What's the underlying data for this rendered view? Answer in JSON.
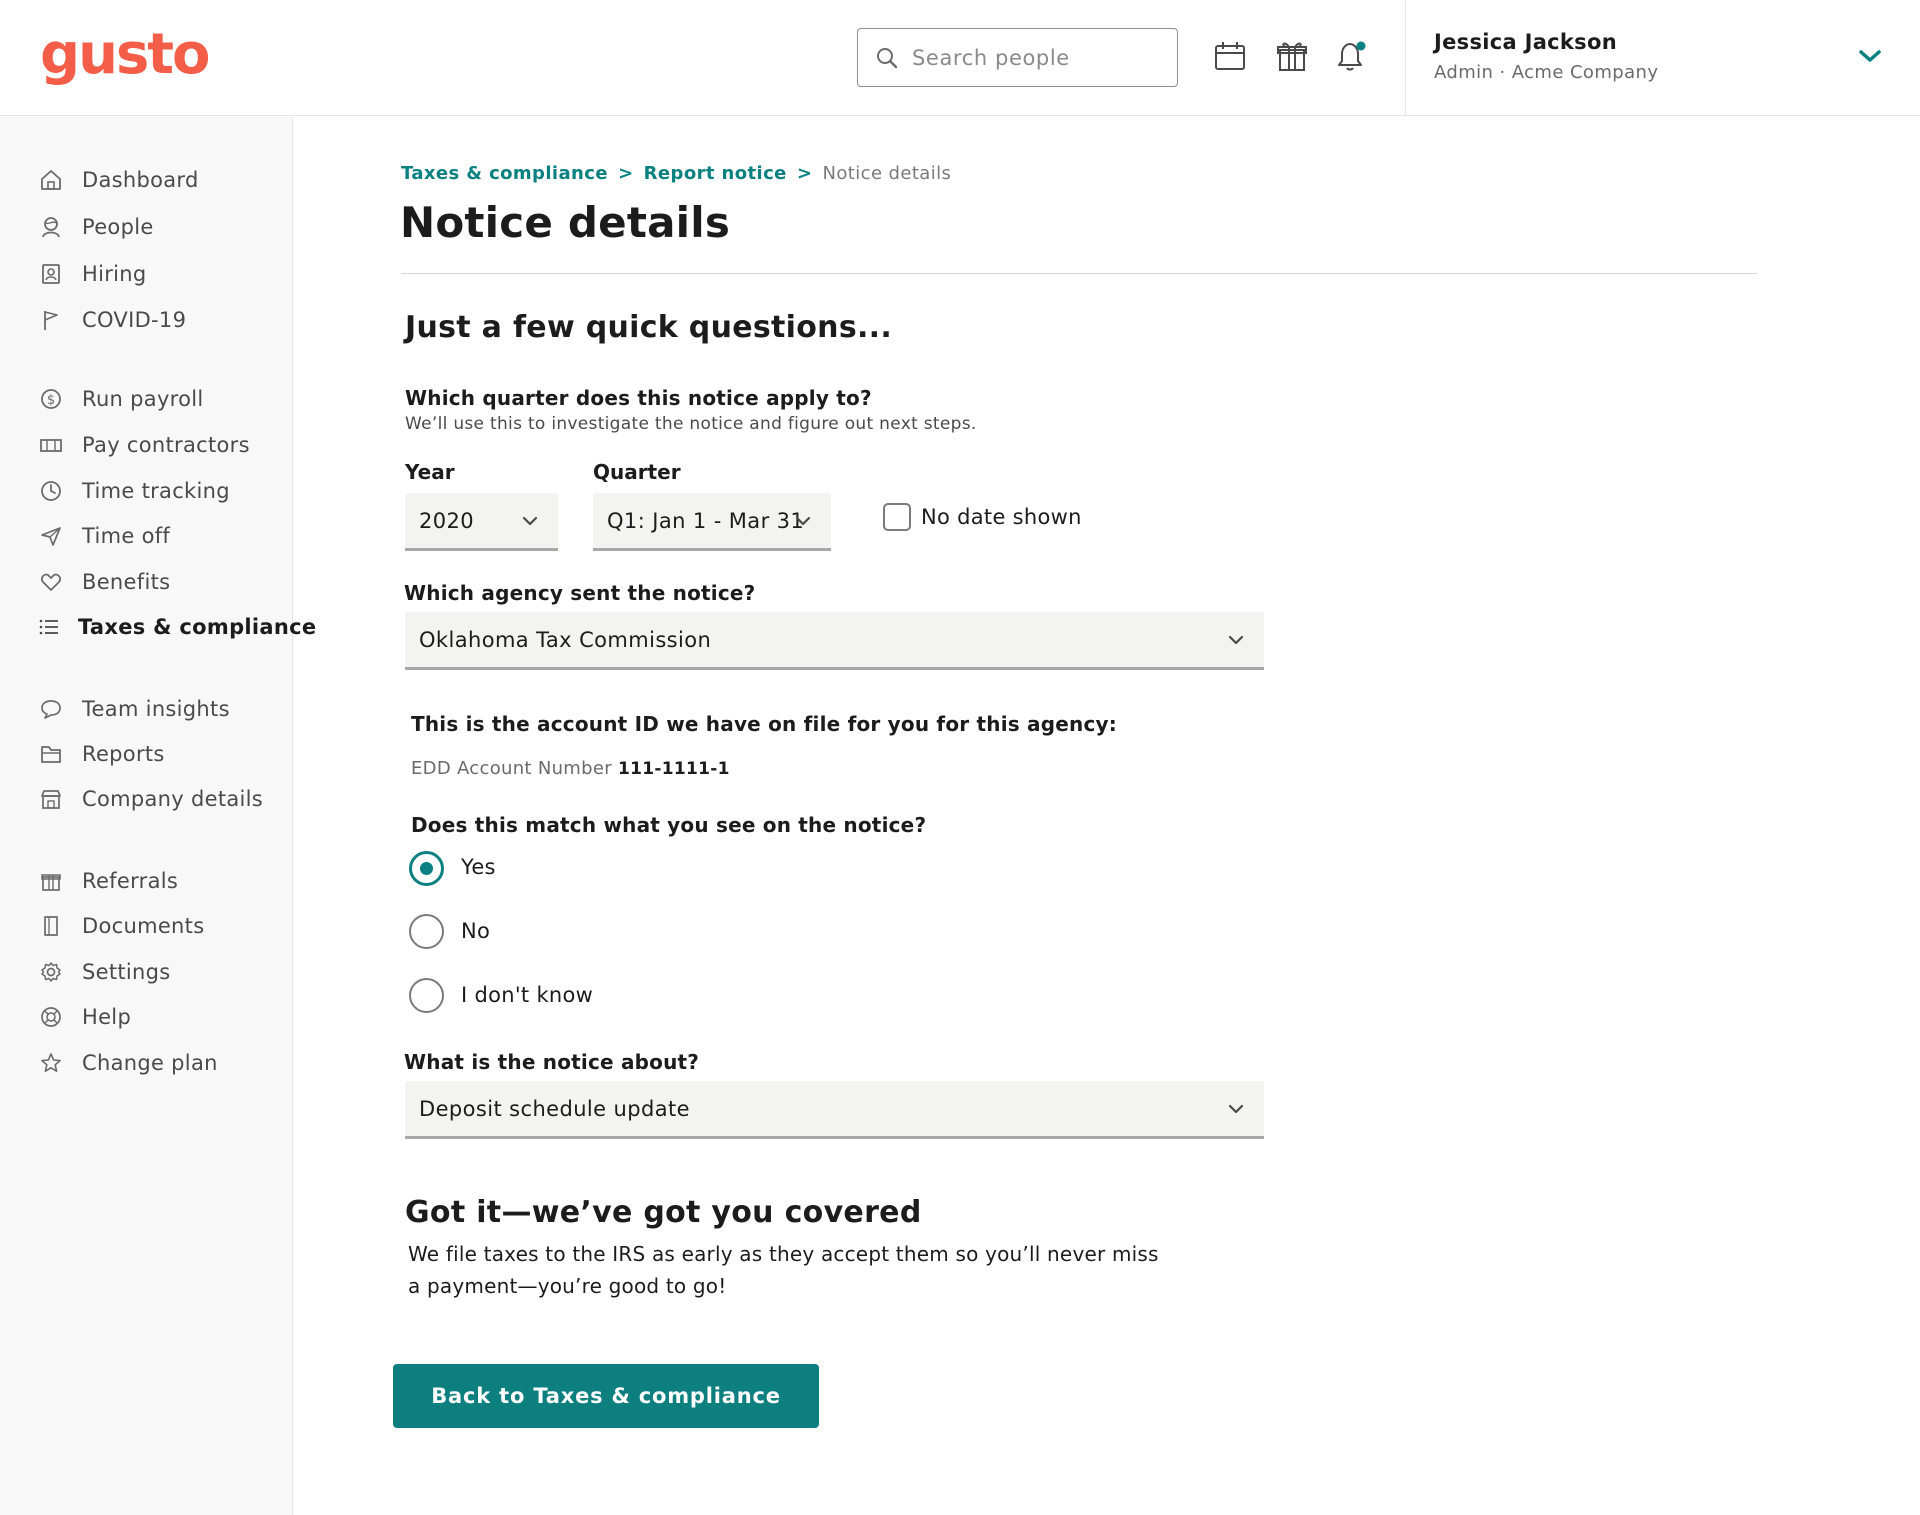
{
  "brand": {
    "logo_text": "gusto",
    "color": "#f45d48",
    "accent": "#0a8080"
  },
  "header": {
    "search_placeholder": "Search people",
    "icons": [
      "calendar-icon",
      "gift-icon",
      "bell-icon"
    ],
    "user": {
      "name": "Jessica Jackson",
      "role": "Admin · Acme Company"
    }
  },
  "sidebar": {
    "items": [
      {
        "label": "Dashboard",
        "icon": "home-icon"
      },
      {
        "label": "People",
        "icon": "people-icon"
      },
      {
        "label": "Hiring",
        "icon": "hiring-icon"
      },
      {
        "label": "COVID-19",
        "icon": "flag-icon"
      },
      {
        "label": "Run payroll",
        "icon": "dollar-icon"
      },
      {
        "label": "Pay contractors",
        "icon": "cash-icon"
      },
      {
        "label": "Time tracking",
        "icon": "clock-icon"
      },
      {
        "label": "Time off",
        "icon": "plane-icon"
      },
      {
        "label": "Benefits",
        "icon": "heart-icon"
      },
      {
        "label": "Taxes & compliance",
        "icon": "list-icon",
        "active": true
      },
      {
        "label": "Team insights",
        "icon": "chat-icon"
      },
      {
        "label": "Reports",
        "icon": "folder-icon"
      },
      {
        "label": "Company details",
        "icon": "store-icon"
      },
      {
        "label": "Referrals",
        "icon": "gift-icon"
      },
      {
        "label": "Documents",
        "icon": "document-icon"
      },
      {
        "label": "Settings",
        "icon": "gear-icon"
      },
      {
        "label": "Help",
        "icon": "lifebuoy-icon"
      },
      {
        "label": "Change plan",
        "icon": "star-icon"
      }
    ]
  },
  "breadcrumb": {
    "items": [
      "Taxes & compliance",
      "Report notice"
    ],
    "separator": ">",
    "current": "Notice details"
  },
  "page": {
    "title": "Notice details",
    "section_title": "Just a few quick questions...",
    "quarter_question": "Which quarter does this notice apply to?",
    "quarter_help": "We’ll use this to investigate the notice and figure out next steps.",
    "year_label": "Year",
    "year_value": "2020",
    "quarter_label": "Quarter",
    "quarter_value": "Q1: Jan 1 - Mar 31",
    "no_date_label": "No date shown",
    "no_date_checked": false,
    "agency_question": "Which agency sent the notice?",
    "agency_value": "Oklahoma Tax Commission",
    "account_intro": "This is the account ID we have on file for you for this agency:",
    "account_key": "EDD Account Number",
    "account_value": "111-1111-1",
    "match_question": "Does this match what you see on the notice?",
    "match_options": [
      "Yes",
      "No",
      "I don't know"
    ],
    "match_selected": "Yes",
    "about_question": "What is the notice about?",
    "about_value": "Deposit schedule update",
    "result_title": "Got it—we’ve got you covered",
    "result_body": "We file taxes to the IRS as early as they accept them so you’ll never miss a payment—you’re good to go!",
    "back_button": "Back to Taxes & compliance"
  }
}
